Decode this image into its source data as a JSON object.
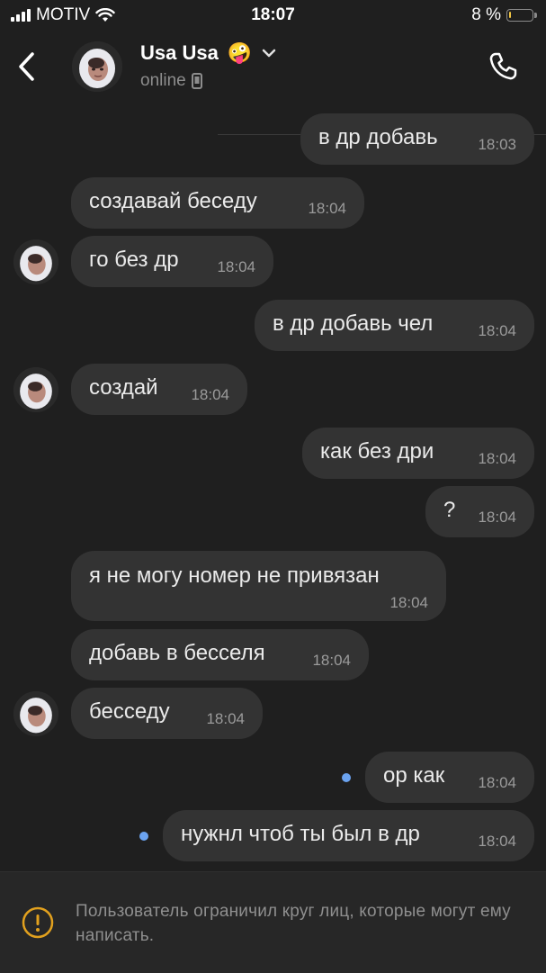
{
  "status_bar": {
    "carrier": "MOTIV",
    "time": "18:07",
    "battery_percent": "8 %",
    "battery_level": 0.08,
    "battery_color": "#f2c744"
  },
  "header": {
    "contact_name": "Usa Usa",
    "emoji": "🤪",
    "status": "online"
  },
  "messages": [
    {
      "side": "out",
      "text": "в др добавь",
      "time": "18:03"
    },
    {
      "side": "in",
      "text": "создавай беседу",
      "time": "18:04"
    },
    {
      "side": "in",
      "text": "го без др",
      "time": "18:04"
    },
    {
      "side": "out",
      "text": "в др добавь чел",
      "time": "18:04"
    },
    {
      "side": "in",
      "text": "создай",
      "time": "18:04"
    },
    {
      "side": "out",
      "text": "как без дри",
      "time": "18:04"
    },
    {
      "side": "out",
      "text": "?",
      "time": "18:04"
    },
    {
      "side": "in",
      "text": "я не могу номер не привязан",
      "time": "18:04"
    },
    {
      "side": "in",
      "text": "добавь в бесселя",
      "time": "18:04"
    },
    {
      "side": "in",
      "text": "бесседу",
      "time": "18:04"
    },
    {
      "side": "out",
      "text": "ор как",
      "time": "18:04",
      "unread": true
    },
    {
      "side": "out",
      "text": "нужнл чтоб ты был в др",
      "time": "18:04",
      "unread": true
    }
  ],
  "notice": {
    "text": "Пользователь ограничил круг лиц, которые могут ему написать."
  },
  "colors": {
    "background": "#1f1f1f",
    "bubble": "#333333",
    "unread_dot": "#6ba3f0",
    "notice_icon": "#e2a11e"
  }
}
